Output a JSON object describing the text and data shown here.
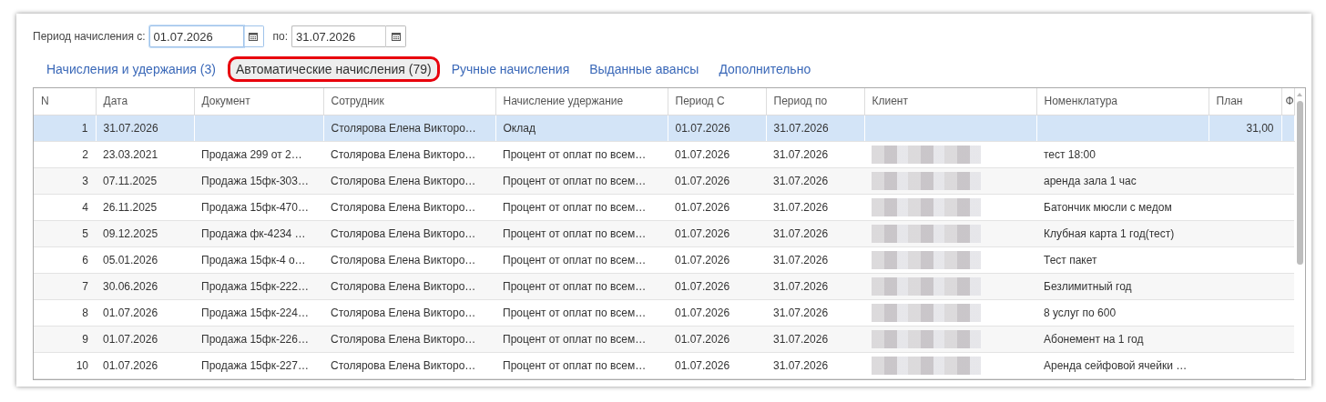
{
  "period": {
    "from_label": "Период начисления с:",
    "from": {
      "value": "01.07.2026",
      "focused": true
    },
    "to_label": "по:",
    "to": {
      "value": "31.07.2026",
      "focused": false
    }
  },
  "tabs": [
    {
      "label": "Начисления и удержания (3)",
      "selected": false,
      "highlighted": false
    },
    {
      "label": "Автоматические начисления (79)",
      "selected": true,
      "highlighted": true
    },
    {
      "label": "Ручные начисления",
      "selected": false,
      "highlighted": false
    },
    {
      "label": "Выданные авансы",
      "selected": false,
      "highlighted": false
    },
    {
      "label": "Дополнительно",
      "selected": false,
      "highlighted": false
    }
  ],
  "table": {
    "columns": [
      "N",
      "Дата",
      "Документ",
      "Сотрудник",
      "Начисление удержание",
      "Период С",
      "Период по",
      "Клиент",
      "Номенклатура",
      "План",
      "Ф"
    ],
    "rows": [
      {
        "selected": true,
        "n": "1",
        "date": "31.07.2026",
        "document": "",
        "employee": "Столярова Елена Викторо…",
        "accrual": "Оклад",
        "period_from": "01.07.2026",
        "period_to": "31.07.2026",
        "client_blurred": false,
        "item": "",
        "plan": "31,00"
      },
      {
        "selected": false,
        "n": "2",
        "date": "23.03.2021",
        "document": "Продажа 299 от 2…",
        "employee": "Столярова Елена Викторо…",
        "accrual": "Процент от  оплат по всем…",
        "period_from": "01.07.2026",
        "period_to": "31.07.2026",
        "client_blurred": true,
        "item": "тест 18:00",
        "plan": ""
      },
      {
        "selected": false,
        "n": "3",
        "date": "07.11.2025",
        "document": "Продажа 15фк-303…",
        "employee": "Столярова Елена Викторо…",
        "accrual": "Процент от  оплат по всем…",
        "period_from": "01.07.2026",
        "period_to": "31.07.2026",
        "client_blurred": true,
        "item": "аренда зала 1 час",
        "plan": ""
      },
      {
        "selected": false,
        "n": "4",
        "date": "26.11.2025",
        "document": "Продажа 15фк-470…",
        "employee": "Столярова Елена Викторо…",
        "accrual": "Процент от  оплат по всем…",
        "period_from": "01.07.2026",
        "period_to": "31.07.2026",
        "client_blurred": true,
        "item": "Батончик мюсли с медом",
        "plan": ""
      },
      {
        "selected": false,
        "n": "5",
        "date": "09.12.2025",
        "document": "Продажа фк-4234 …",
        "employee": "Столярова Елена Викторо…",
        "accrual": "Процент от  оплат по всем…",
        "period_from": "01.07.2026",
        "period_to": "31.07.2026",
        "client_blurred": true,
        "item": "Клубная карта 1 год(тест)",
        "plan": ""
      },
      {
        "selected": false,
        "n": "6",
        "date": "05.01.2026",
        "document": "Продажа 15фк-4 о…",
        "employee": "Столярова Елена Викторо…",
        "accrual": "Процент от  оплат по всем…",
        "period_from": "01.07.2026",
        "period_to": "31.07.2026",
        "client_blurred": true,
        "item": "Тест пакет",
        "plan": ""
      },
      {
        "selected": false,
        "n": "7",
        "date": "30.06.2026",
        "document": "Продажа 15фк-222…",
        "employee": "Столярова Елена Викторо…",
        "accrual": "Процент от  оплат по всем…",
        "period_from": "01.07.2026",
        "period_to": "31.07.2026",
        "client_blurred": true,
        "item": "Безлимитный год",
        "plan": ""
      },
      {
        "selected": false,
        "n": "8",
        "date": "01.07.2026",
        "document": "Продажа 15фк-224…",
        "employee": "Столярова Елена Викторо…",
        "accrual": "Процент от  оплат по всем…",
        "period_from": "01.07.2026",
        "period_to": "31.07.2026",
        "client_blurred": true,
        "item": "8 услуг по 600",
        "plan": ""
      },
      {
        "selected": false,
        "n": "9",
        "date": "01.07.2026",
        "document": "Продажа 15фк-226…",
        "employee": "Столярова Елена Викторо…",
        "accrual": "Процент от  оплат по всем…",
        "period_from": "01.07.2026",
        "period_to": "31.07.2026",
        "client_blurred": true,
        "item": "Абонемент на 1 год",
        "plan": ""
      },
      {
        "selected": false,
        "n": "10",
        "date": "01.07.2026",
        "document": "Продажа 15фк-227…",
        "employee": "Столярова Елена Викторо…",
        "accrual": "Процент от  оплат по всем…",
        "period_from": "01.07.2026",
        "period_to": "31.07.2026",
        "client_blurred": true,
        "item": "Аренда сейфовой ячейки …",
        "plan": ""
      }
    ]
  }
}
